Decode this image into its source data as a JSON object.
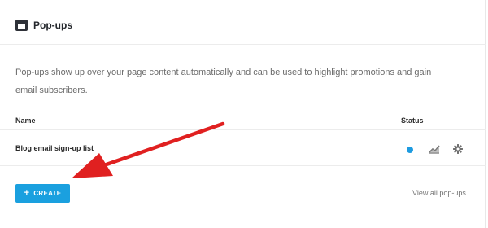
{
  "header": {
    "icon": "popup-window-icon",
    "title": "Pop-ups"
  },
  "description": "Pop-ups show up over your page content automatically and can be used to highlight promotions and gain email subscribers.",
  "table": {
    "columns": [
      "Name",
      "Status"
    ],
    "rows": [
      {
        "name": "Blog email sign-up list",
        "status_color": "#1e9be0",
        "actions": [
          "stats-icon",
          "gear-icon"
        ]
      }
    ]
  },
  "footer": {
    "create_label": "CREATE",
    "create_icon": "plus-icon",
    "view_all_label": "View all pop-ups"
  },
  "colors": {
    "accent": "#1aa0df",
    "annotation_arrow": "#e02020"
  }
}
